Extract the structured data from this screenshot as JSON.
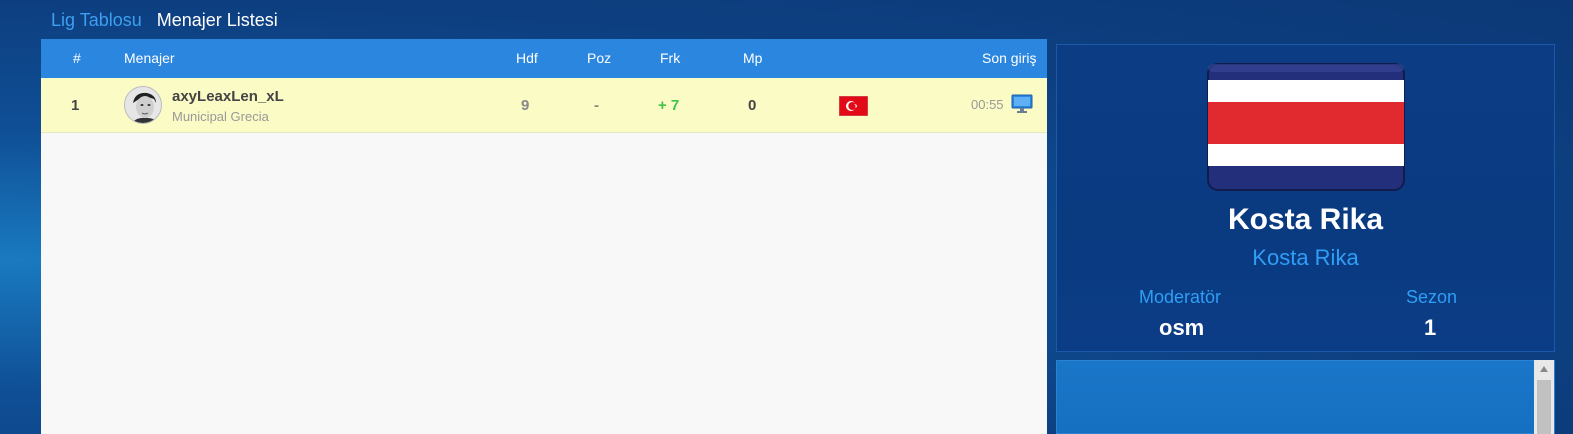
{
  "tabs": [
    {
      "label": "Lig Tablosu",
      "active": true
    },
    {
      "label": "Menajer Listesi",
      "active": false
    }
  ],
  "table": {
    "headers": {
      "rank": "#",
      "manager": "Menajer",
      "hdf": "Hdf",
      "poz": "Poz",
      "frk": "Frk",
      "mp": "Mp",
      "last_login": "Son giriş"
    },
    "rows": [
      {
        "rank": "1",
        "name": "axyLeaxLen_xL",
        "team": "Municipal Grecia",
        "hdf": "9",
        "poz": "-",
        "frk": "+ 7",
        "mp": "0",
        "flag": "turkey-flag-icon",
        "time": "00:55",
        "device": "monitor-icon"
      }
    ]
  },
  "side": {
    "flag": "costa-rica-flag",
    "title": "Kosta Rika",
    "subtitle": "Kosta Rika",
    "moderator_label": "Moderatör",
    "moderator_value": "osm",
    "season_label": "Sezon",
    "season_value": "1"
  },
  "colors": {
    "header_blue": "#2b86e0",
    "highlight_row": "#fbfbc6",
    "accent_blue": "#2f9ef5",
    "positive_green": "#43c24a"
  }
}
